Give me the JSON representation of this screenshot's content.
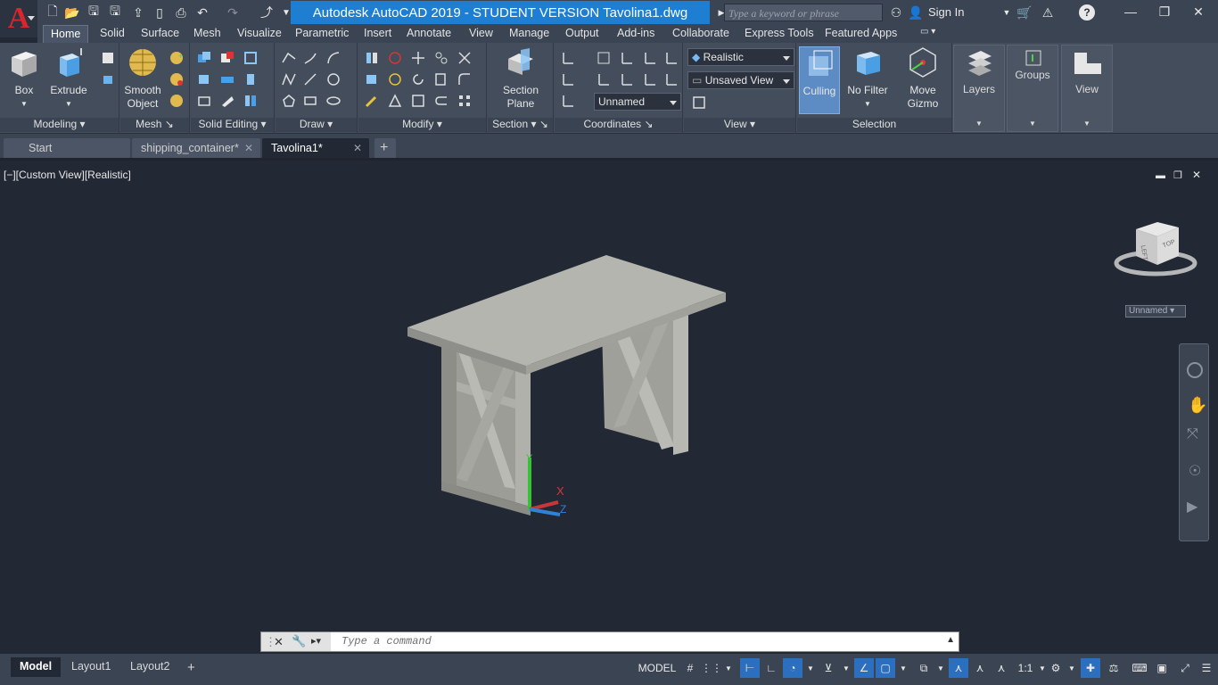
{
  "title": "Autodesk AutoCAD 2019 - STUDENT VERSION    Tavolina1.dwg",
  "search_placeholder": "Type a keyword or phrase",
  "sign_in": "Sign In",
  "ribbon_tabs": [
    "Home",
    "Solid",
    "Surface",
    "Mesh",
    "Visualize",
    "Parametric",
    "Insert",
    "Annotate",
    "View",
    "Manage",
    "Output",
    "Add-ins",
    "Collaborate",
    "Express Tools",
    "Featured Apps"
  ],
  "modeling": {
    "box": "Box",
    "extrude": "Extrude",
    "title": "Modeling"
  },
  "mesh": {
    "smooth1": "Smooth",
    "smooth2": "Object",
    "title": "Mesh"
  },
  "solid_editing": {
    "title": "Solid Editing"
  },
  "draw": {
    "title": "Draw"
  },
  "modify": {
    "title": "Modify"
  },
  "section": {
    "label1": "Section",
    "label2": "Plane",
    "title": "Section"
  },
  "coordinates": {
    "ucs": "Unnamed",
    "title": "Coordinates"
  },
  "view": {
    "visual_style": "Realistic",
    "saved_view": "Unsaved View",
    "title": "View"
  },
  "selection": {
    "culling": "Culling",
    "nofilter": "No Filter",
    "gizmo1": "Move",
    "gizmo2": "Gizmo",
    "title": "Selection"
  },
  "side": {
    "layers": "Layers",
    "groups": "Groups",
    "view": "View"
  },
  "doc_tabs": [
    "Start",
    "shipping_container*",
    "Tavolina1*"
  ],
  "viewport_label": "[−][Custom View][Realistic]",
  "viewcube": {
    "left": "LEFT",
    "top": "TOP",
    "ucs": "Unnamed"
  },
  "cmd_placeholder": "Type a command",
  "layout_tabs": [
    "Model",
    "Layout1",
    "Layout2"
  ],
  "status": {
    "model": "MODEL",
    "scale": "1:1"
  },
  "colors": {
    "accent": "#1e7fd2",
    "table": "#a2a39d",
    "background": "#222834"
  }
}
